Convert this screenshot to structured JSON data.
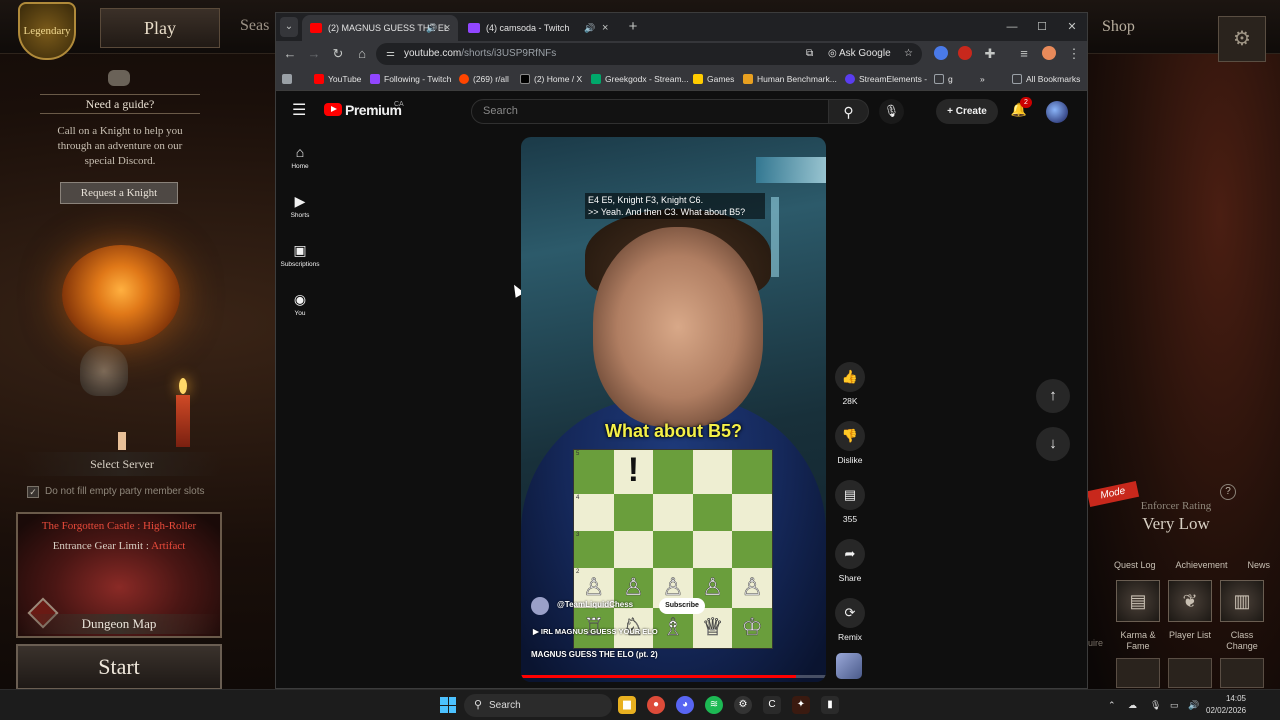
{
  "game": {
    "rank_badge": "Legendary",
    "play_label": "Play",
    "season_label": "Seas",
    "shop_label": "Shop",
    "map_icon": "map-icon",
    "guide": {
      "title": "Need a guide?",
      "text": "Call on a Knight to help you through an adventure on our special Discord.",
      "button": "Request a Knight"
    },
    "select_server": "Select Server",
    "party_checkbox_label": "Do not fill empty party member slots",
    "party_checkbox_checked": true,
    "dungeon": {
      "title": "The Forgotten Castle : High-Roller",
      "gear_limit_label": "Entrance Gear Limit :",
      "gear_limit_value": "Artifact",
      "map_label": "Dungeon Map"
    },
    "start_label": "Start",
    "mode_badge": "Mode",
    "enforcer": {
      "label": "Enforcer Rating",
      "value": "Very Low"
    },
    "right_tabs": [
      "Quest Log",
      "Achievement",
      "News"
    ],
    "right_buttons": [
      {
        "label": "Karma & Fame",
        "icon": "book-icon"
      },
      {
        "label": "Player List",
        "icon": "laurel-icon"
      },
      {
        "label": "Class Change",
        "icon": "scroll-icon"
      }
    ],
    "quire_label": "uire"
  },
  "browser": {
    "tabs": [
      {
        "title": "(2) MAGNUS GUESS THE EL",
        "active": true,
        "favicon_color": "#ff0000",
        "audio": true
      },
      {
        "title": "(4) camsoda - Twitch",
        "active": false,
        "favicon_color": "#9146ff",
        "audio": true
      }
    ],
    "url_host": "youtube.com",
    "url_path": "/shorts/i3USP9RfNFs",
    "ask_google": "Ask Google",
    "bookmarks": [
      {
        "label": "YouTube",
        "color": "#ff0000"
      },
      {
        "label": "Following - Twitch",
        "color": "#9146ff"
      },
      {
        "label": "(269) r/all",
        "color": "#ff4500"
      },
      {
        "label": "(2) Home / X",
        "color": "#000000"
      },
      {
        "label": "Greekgodx - Stream...",
        "color": "#00a86b"
      },
      {
        "label": "Games",
        "color": "#ffcc00"
      },
      {
        "label": "Human Benchmark...",
        "color": "#e8a020"
      },
      {
        "label": "StreamElements -",
        "color": "#5a3df0"
      },
      {
        "label": "g",
        "color": "#9aa0a6"
      }
    ],
    "all_bookmarks": "All Bookmarks",
    "more_bookmarks": "»"
  },
  "youtube": {
    "brand": "Premium",
    "region": "CA",
    "search_placeholder": "Search",
    "create_label": "Create",
    "notifications": "2",
    "sidebar": [
      {
        "label": "Home",
        "icon": "home-icon",
        "glyph": "⌂"
      },
      {
        "label": "Shorts",
        "icon": "shorts-icon",
        "glyph": "▶"
      },
      {
        "label": "Subscriptions",
        "icon": "subscriptions-icon",
        "glyph": "▣"
      },
      {
        "label": "You",
        "icon": "you-icon",
        "glyph": "◉"
      }
    ],
    "short": {
      "caption_line1": "E4 E5, Knight F3, Knight C6.",
      "caption_line2": ">> Yeah. And then C3. What about B5?",
      "big_caption": "What about B5?",
      "channel": "@TeamLiquidChess",
      "subscribe": "Subscribe",
      "music": "IRL MAGNUS GUESS YOUR ELO",
      "title": "MAGNUS GUESS THE ELO (pt. 2)",
      "progress": 0.9,
      "board_ranks": [
        "5",
        "4",
        "3",
        "2",
        ""
      ],
      "board_rows": [
        [
          "",
          "!",
          "",
          "",
          ""
        ],
        [
          "",
          "",
          "",
          "",
          ""
        ],
        [
          "",
          "",
          "",
          "",
          ""
        ],
        [
          "♙",
          "♙",
          "♙",
          "♙",
          "♙"
        ],
        [
          "♖",
          "♘",
          "♗",
          "♕",
          "♔"
        ]
      ]
    },
    "actions": {
      "likes": "28K",
      "dislike": "Dislike",
      "comments": "355",
      "share": "Share",
      "remix": "Remix"
    }
  },
  "taskbar": {
    "search": "Search",
    "time": "14:05",
    "date": "02/02/2026"
  }
}
